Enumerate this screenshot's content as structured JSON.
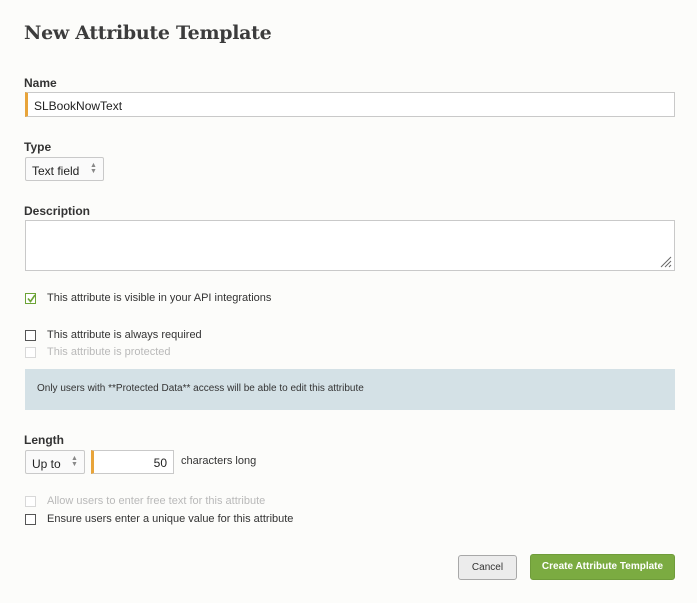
{
  "form": {
    "title": "New Attribute Template",
    "name_label": "Name",
    "name_value": "SLBookNowText",
    "type_label": "Type",
    "type_value": "Text field",
    "description_label": "Description",
    "description_value": ""
  },
  "options": {
    "visible_api": {
      "label": "This attribute is visible in your API integrations",
      "checked": true
    },
    "always_required": {
      "label": "This attribute is always required",
      "checked": false
    },
    "protected": {
      "label": "This attribute is protected",
      "checked": false,
      "disabled": true
    }
  },
  "note": "Only users with **Protected Data** access will be able to edit this attribute",
  "length": {
    "label": "Length",
    "mode": "Up to",
    "value": "50",
    "suffix": "characters long"
  },
  "extra_options": {
    "free_text": {
      "label": "Allow users to enter free text for this attribute",
      "checked": false,
      "disabled": true
    },
    "unique": {
      "label": "Ensure users enter a unique value for this attribute",
      "checked": false
    }
  },
  "buttons": {
    "cancel": "Cancel",
    "create": "Create Attribute Template"
  },
  "colors": {
    "accent_green": "#7bab41",
    "focus_orange": "#e8a43a",
    "note_bg": "#d4e1e6"
  }
}
